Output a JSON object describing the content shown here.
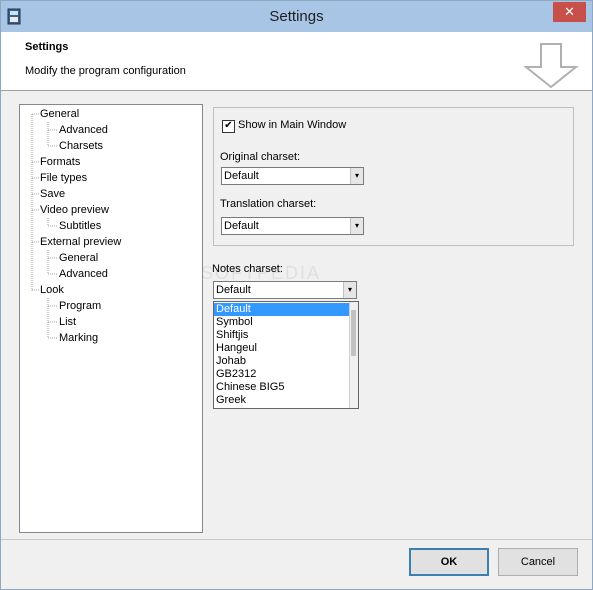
{
  "window": {
    "title": "Settings",
    "close_label": "✕"
  },
  "header": {
    "title": "Settings",
    "subtitle": "Modify the program configuration"
  },
  "tree": {
    "items": [
      {
        "label": "General",
        "level": 0
      },
      {
        "label": "Advanced",
        "level": 1
      },
      {
        "label": "Charsets",
        "level": 1
      },
      {
        "label": "Formats",
        "level": 0
      },
      {
        "label": "File types",
        "level": 0
      },
      {
        "label": "Save",
        "level": 0
      },
      {
        "label": "Video preview",
        "level": 0
      },
      {
        "label": "Subtitles",
        "level": 1
      },
      {
        "label": "External preview",
        "level": 0
      },
      {
        "label": "General",
        "level": 1
      },
      {
        "label": "Advanced",
        "level": 1
      },
      {
        "label": "Look",
        "level": 0
      },
      {
        "label": "Program",
        "level": 1
      },
      {
        "label": "List",
        "level": 1
      },
      {
        "label": "Marking",
        "level": 1
      }
    ]
  },
  "panel": {
    "show_main_window": {
      "label": "Show in Main Window",
      "checked": true
    },
    "original_charset": {
      "label": "Original charset:",
      "value": "Default"
    },
    "translation_charset": {
      "label": "Translation charset:",
      "value": "Default"
    },
    "notes_charset": {
      "label": "Notes charset:",
      "value": "Default",
      "options": [
        "Default",
        "Symbol",
        "Shiftjis",
        "Hangeul",
        "Johab",
        "GB2312",
        "Chinese BIG5",
        "Greek"
      ],
      "selected_index": 0
    }
  },
  "buttons": {
    "ok": "OK",
    "cancel": "Cancel"
  },
  "watermark": "SOFTPEDIA"
}
